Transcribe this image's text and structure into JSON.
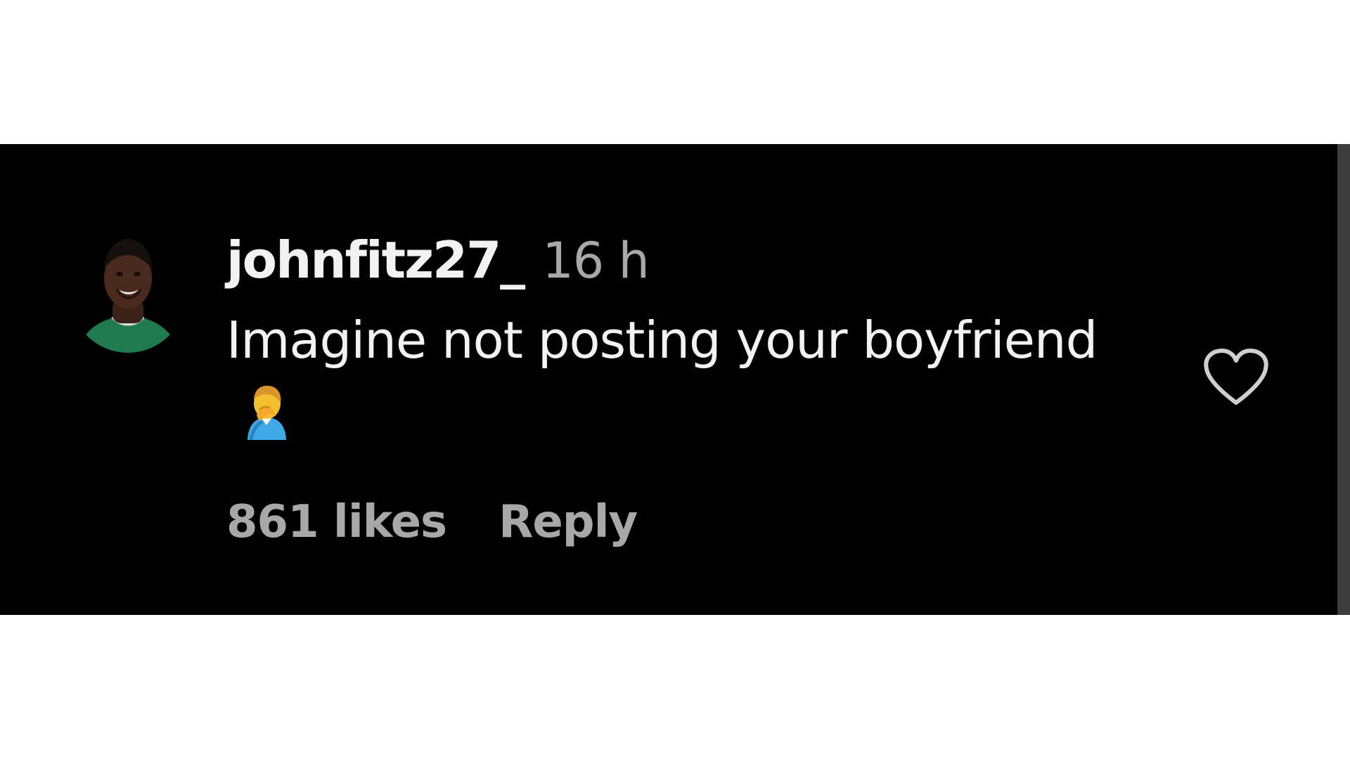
{
  "comment": {
    "username": "johnfitz27_",
    "timestamp": "16 h",
    "text": "Imagine not posting your boyfriend",
    "emoji": "man-facepalming-emoji",
    "likes": "861 likes",
    "reply_label": "Reply",
    "like_icon": "heart-outline-icon"
  },
  "colors": {
    "panel_background": "#000000",
    "primary_text": "#f2f2f2",
    "secondary_text": "#a8a8a8",
    "jersey_green": "#1f7a4d"
  }
}
